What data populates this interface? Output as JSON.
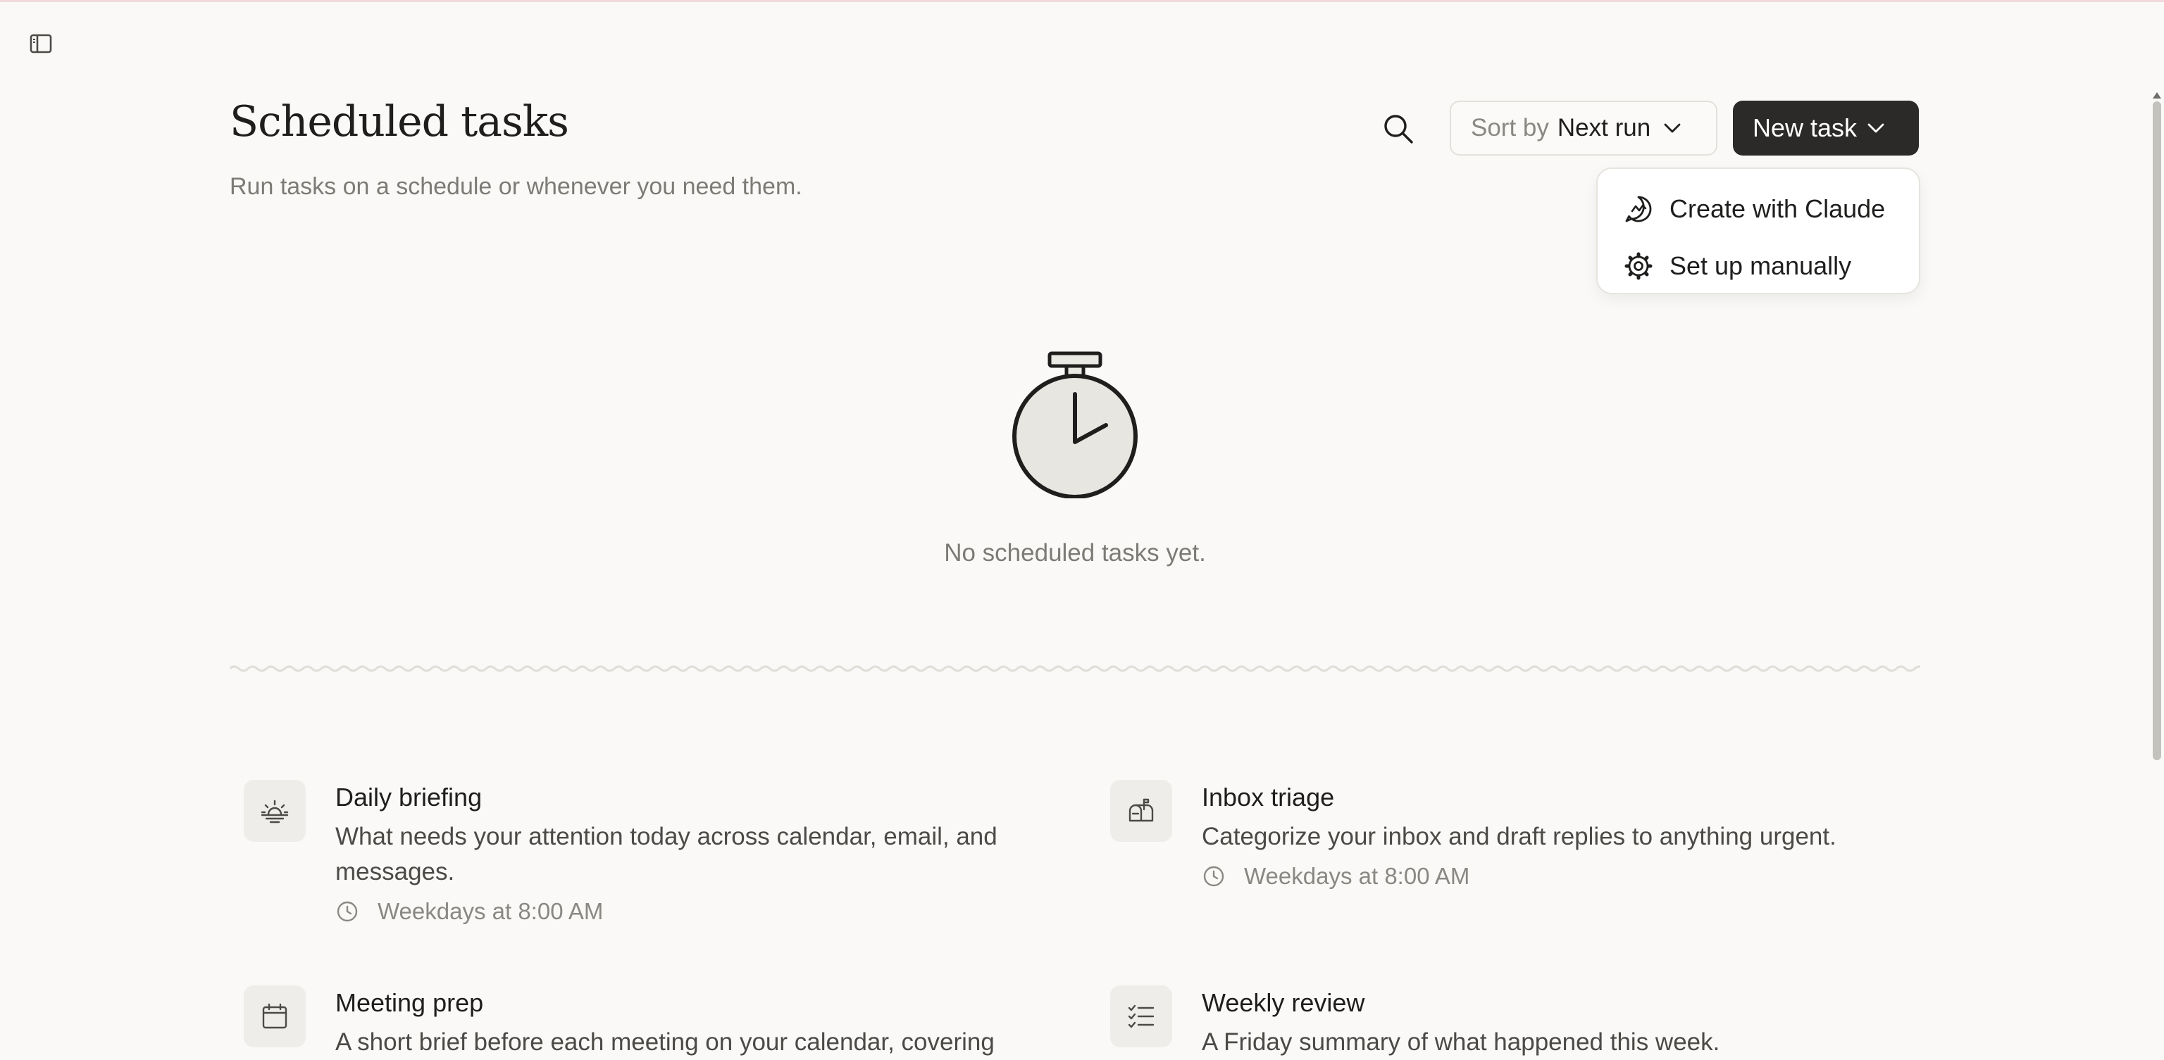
{
  "header": {
    "title": "Scheduled tasks",
    "subtitle": "Run tasks on a schedule or whenever you need them."
  },
  "toolbar": {
    "sort_prefix": "Sort by",
    "sort_value": "Next run",
    "new_task_label": "New task"
  },
  "new_task_menu": {
    "items": [
      {
        "label": "Create with Claude",
        "icon": "chat-sparkle-icon"
      },
      {
        "label": "Set up manually",
        "icon": "gear-icon"
      }
    ]
  },
  "empty_state": {
    "message": "No scheduled tasks yet.",
    "icon": "stopwatch-icon"
  },
  "templates": [
    {
      "title": "Daily briefing",
      "description": "What needs your attention today across calendar, email, and messages.",
      "schedule": "Weekdays at 8:00 AM",
      "icon": "sunrise-icon"
    },
    {
      "title": "Inbox triage",
      "description": "Categorize your inbox and draft replies to anything urgent.",
      "schedule": "Weekdays at 8:00 AM",
      "icon": "mailbox-icon"
    },
    {
      "title": "Meeting prep",
      "description": "A short brief before each meeting on your calendar, covering",
      "icon": "calendar-icon"
    },
    {
      "title": "Weekly review",
      "description": "A Friday summary of what happened this week.",
      "icon": "checklist-icon"
    }
  ]
}
